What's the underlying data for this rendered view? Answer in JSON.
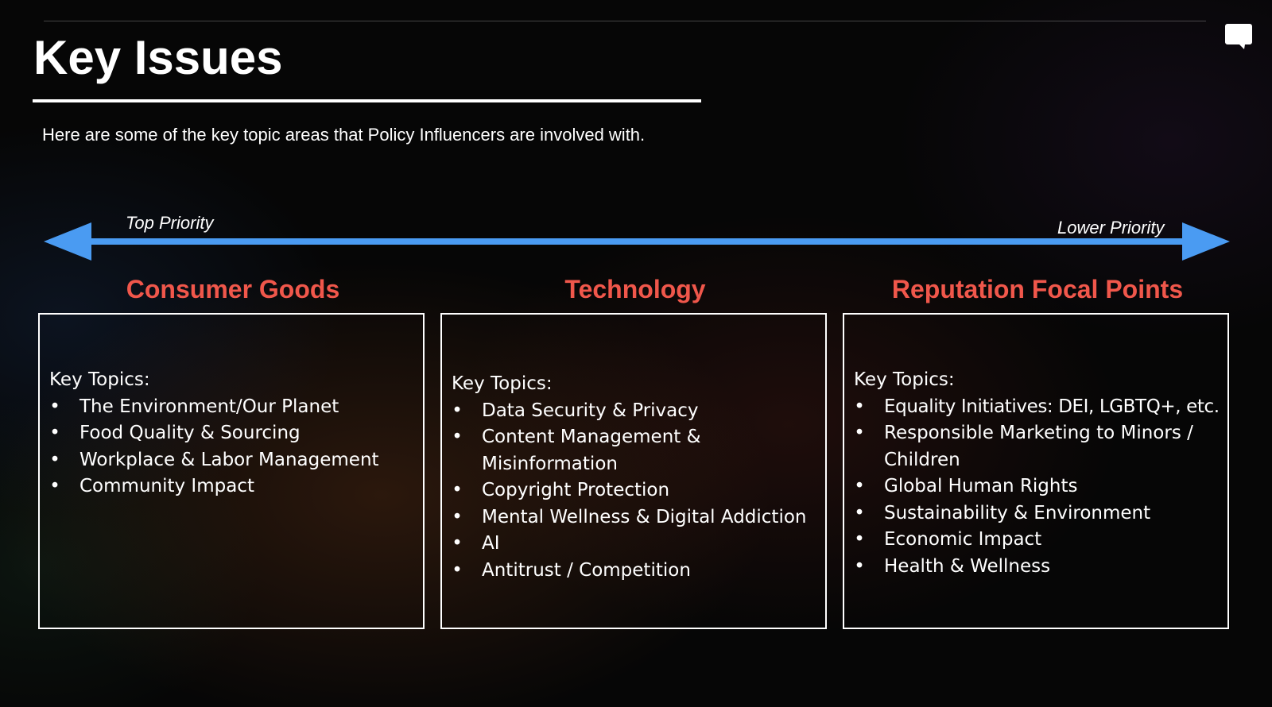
{
  "slide": {
    "title": "Key Issues",
    "subtitle": "Here are some of the key topic areas that Policy Influencers are involved with."
  },
  "priority_scale": {
    "left_label": "Top Priority",
    "right_label": "Lower Priority",
    "arrow_color": "#4a9bf2"
  },
  "colors": {
    "heading_accent": "#f0574b",
    "background": "#060606",
    "text": "#ffffff"
  },
  "icons": {
    "top_right": "comment-icon",
    "bullet": "•"
  },
  "columns": [
    {
      "heading": "Consumer Goods",
      "box_heading": "Key Topics:",
      "topics": [
        "The Environment/Our Planet",
        "Food Quality & Sourcing",
        "Workplace & Labor Management",
        "Community Impact"
      ]
    },
    {
      "heading": "Technology",
      "box_heading": "Key Topics:",
      "topics": [
        "Data Security & Privacy",
        "Content Management & Misinformation",
        "Copyright Protection",
        "Mental Wellness & Digital Addiction",
        "AI",
        "Antitrust / Competition"
      ]
    },
    {
      "heading": "Reputation Focal Points",
      "box_heading": "Key Topics:",
      "topics": [
        "Equality Initiatives: DEI, LGBTQ+, etc.",
        "Responsible Marketing to Minors / Children",
        "Global Human Rights",
        "Sustainability & Environment",
        "Economic Impact",
        "Health & Wellness"
      ]
    }
  ]
}
